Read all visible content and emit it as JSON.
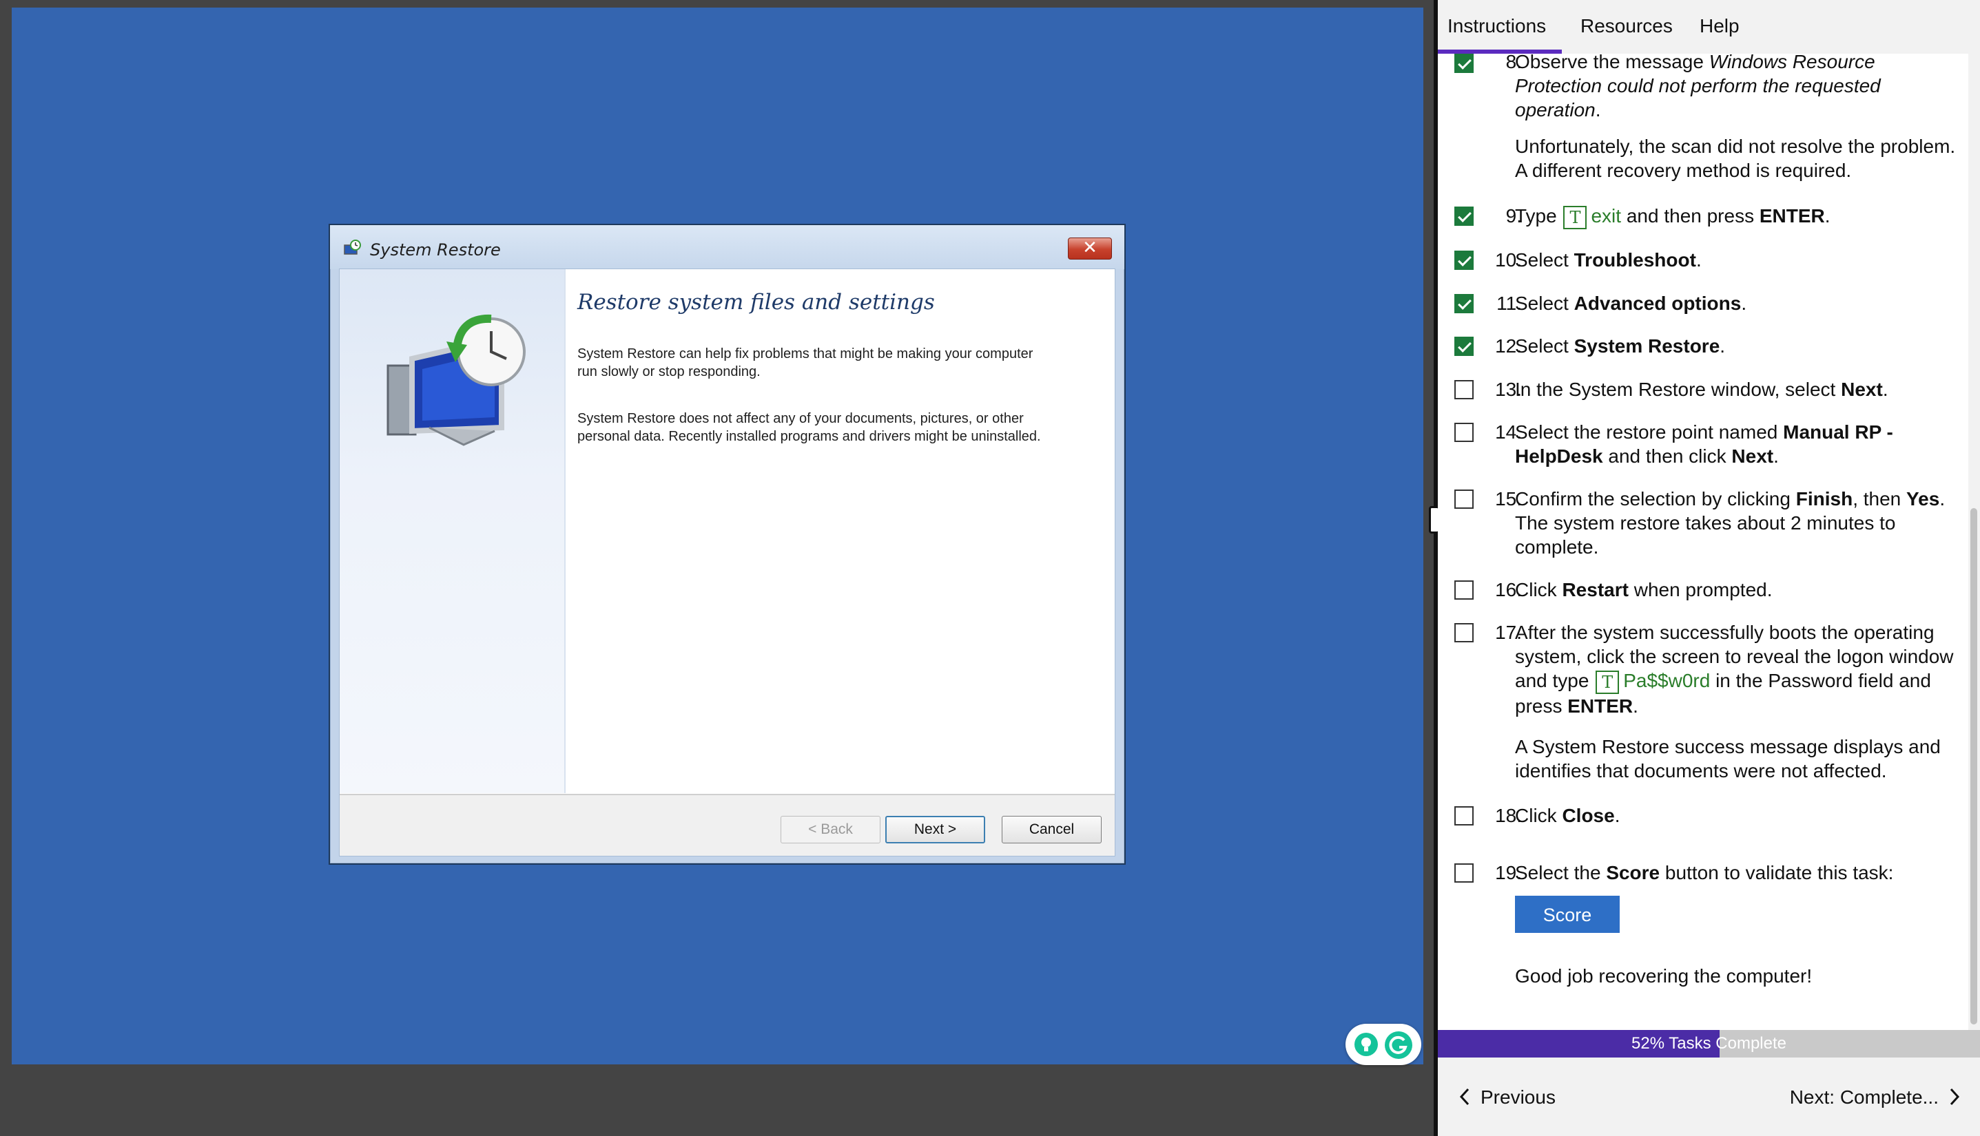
{
  "dialog": {
    "title": "System Restore",
    "heading": "Restore system files and settings",
    "para1": "System Restore can help fix problems that might be making your computer run slowly or stop responding.",
    "para2": "System Restore does not affect any of your documents, pictures, or other personal data. Recently installed programs and drivers might be uninstalled.",
    "back_label": "< Back",
    "next_label": "Next >",
    "cancel_label": "Cancel"
  },
  "tabs": [
    "Instructions",
    "Resources",
    "Help"
  ],
  "steps": {
    "s8": {
      "num": "8.",
      "checked": true,
      "pre": "Observe the message ",
      "em": "Windows Resource Protection could not perform the requested operation",
      "post": ".",
      "note": "Unfortunately, the scan did not resolve the problem. A different recovery method is required."
    },
    "s9": {
      "num": "9.",
      "checked": true,
      "pre": "Type ",
      "typed": "exit",
      "post": " and then press ",
      "b": "ENTER",
      "end": "."
    },
    "s10": {
      "num": "10.",
      "checked": true,
      "pre": "Select ",
      "b": "Troubleshoot",
      "end": "."
    },
    "s11": {
      "num": "11.",
      "checked": true,
      "pre": "Select ",
      "b": "Advanced options",
      "end": "."
    },
    "s12": {
      "num": "12.",
      "checked": true,
      "pre": "Select ",
      "b": "System Restore",
      "end": "."
    },
    "s13": {
      "num": "13.",
      "checked": false,
      "pre": "In the System Restore window, select ",
      "b": "Next",
      "end": "."
    },
    "s14": {
      "num": "14.",
      "checked": false,
      "pre": "Select the restore point named ",
      "b": "Manual RP - HelpDesk",
      "mid": " and then click ",
      "b2": "Next",
      "end": "."
    },
    "s15": {
      "num": "15.",
      "checked": false,
      "pre": "Confirm the selection by clicking ",
      "b": "Finish",
      "mid": ", then ",
      "b2": "Yes",
      "end": ". The system restore takes about 2 minutes to complete."
    },
    "s16": {
      "num": "16.",
      "checked": false,
      "pre": "Click ",
      "b": "Restart",
      "end": " when prompted."
    },
    "s17": {
      "num": "17.",
      "checked": false,
      "pre": "After the system successfully boots the operating system, click the screen to reveal the logon window and type ",
      "typed": "Pa$$w0rd",
      "mid": " in the Password field and press ",
      "b": "ENTER",
      "end": ".",
      "note": "A System Restore success message displays and identifies that documents were not affected."
    },
    "s18": {
      "num": "18.",
      "checked": false,
      "pre": "Click ",
      "b": "Close",
      "end": "."
    },
    "s19": {
      "num": "19.",
      "checked": false,
      "pre": "Select the ",
      "b": "Score",
      "end": " button to validate this task:",
      "score_label": "Score",
      "note": "Good job recovering the computer!"
    }
  },
  "type_badge": "T",
  "progress": {
    "percent": 52,
    "label": "52% Tasks Complete"
  },
  "nav": {
    "prev_label": "Previous",
    "next_label": "Next: Complete..."
  }
}
